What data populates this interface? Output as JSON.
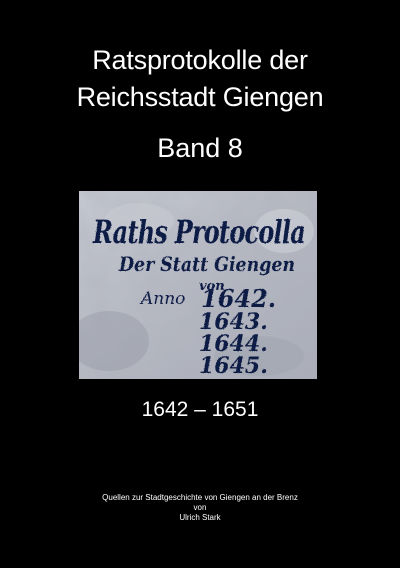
{
  "cover": {
    "title_line_1": "Ratsprotokolle der",
    "title_line_2": "Reichsstadt Giengen",
    "volume": "Band 8",
    "years": "1642 – 1651",
    "series": "Quellen zur Stadtgeschichte von Giengen an der Brenz",
    "by": "von",
    "author": "Ulrich Stark"
  },
  "manuscript_image": {
    "line_1": "Raths Protocolla",
    "line_2": "Der Statt Giengen",
    "line_3": "von",
    "anno_label": "Anno",
    "years": [
      "1642.",
      "1643.",
      "1644.",
      "1645."
    ]
  },
  "colors": {
    "background": "#000000",
    "text": "#ffffff",
    "ink": "#0d1a45",
    "paper": "#b9bcc4"
  }
}
